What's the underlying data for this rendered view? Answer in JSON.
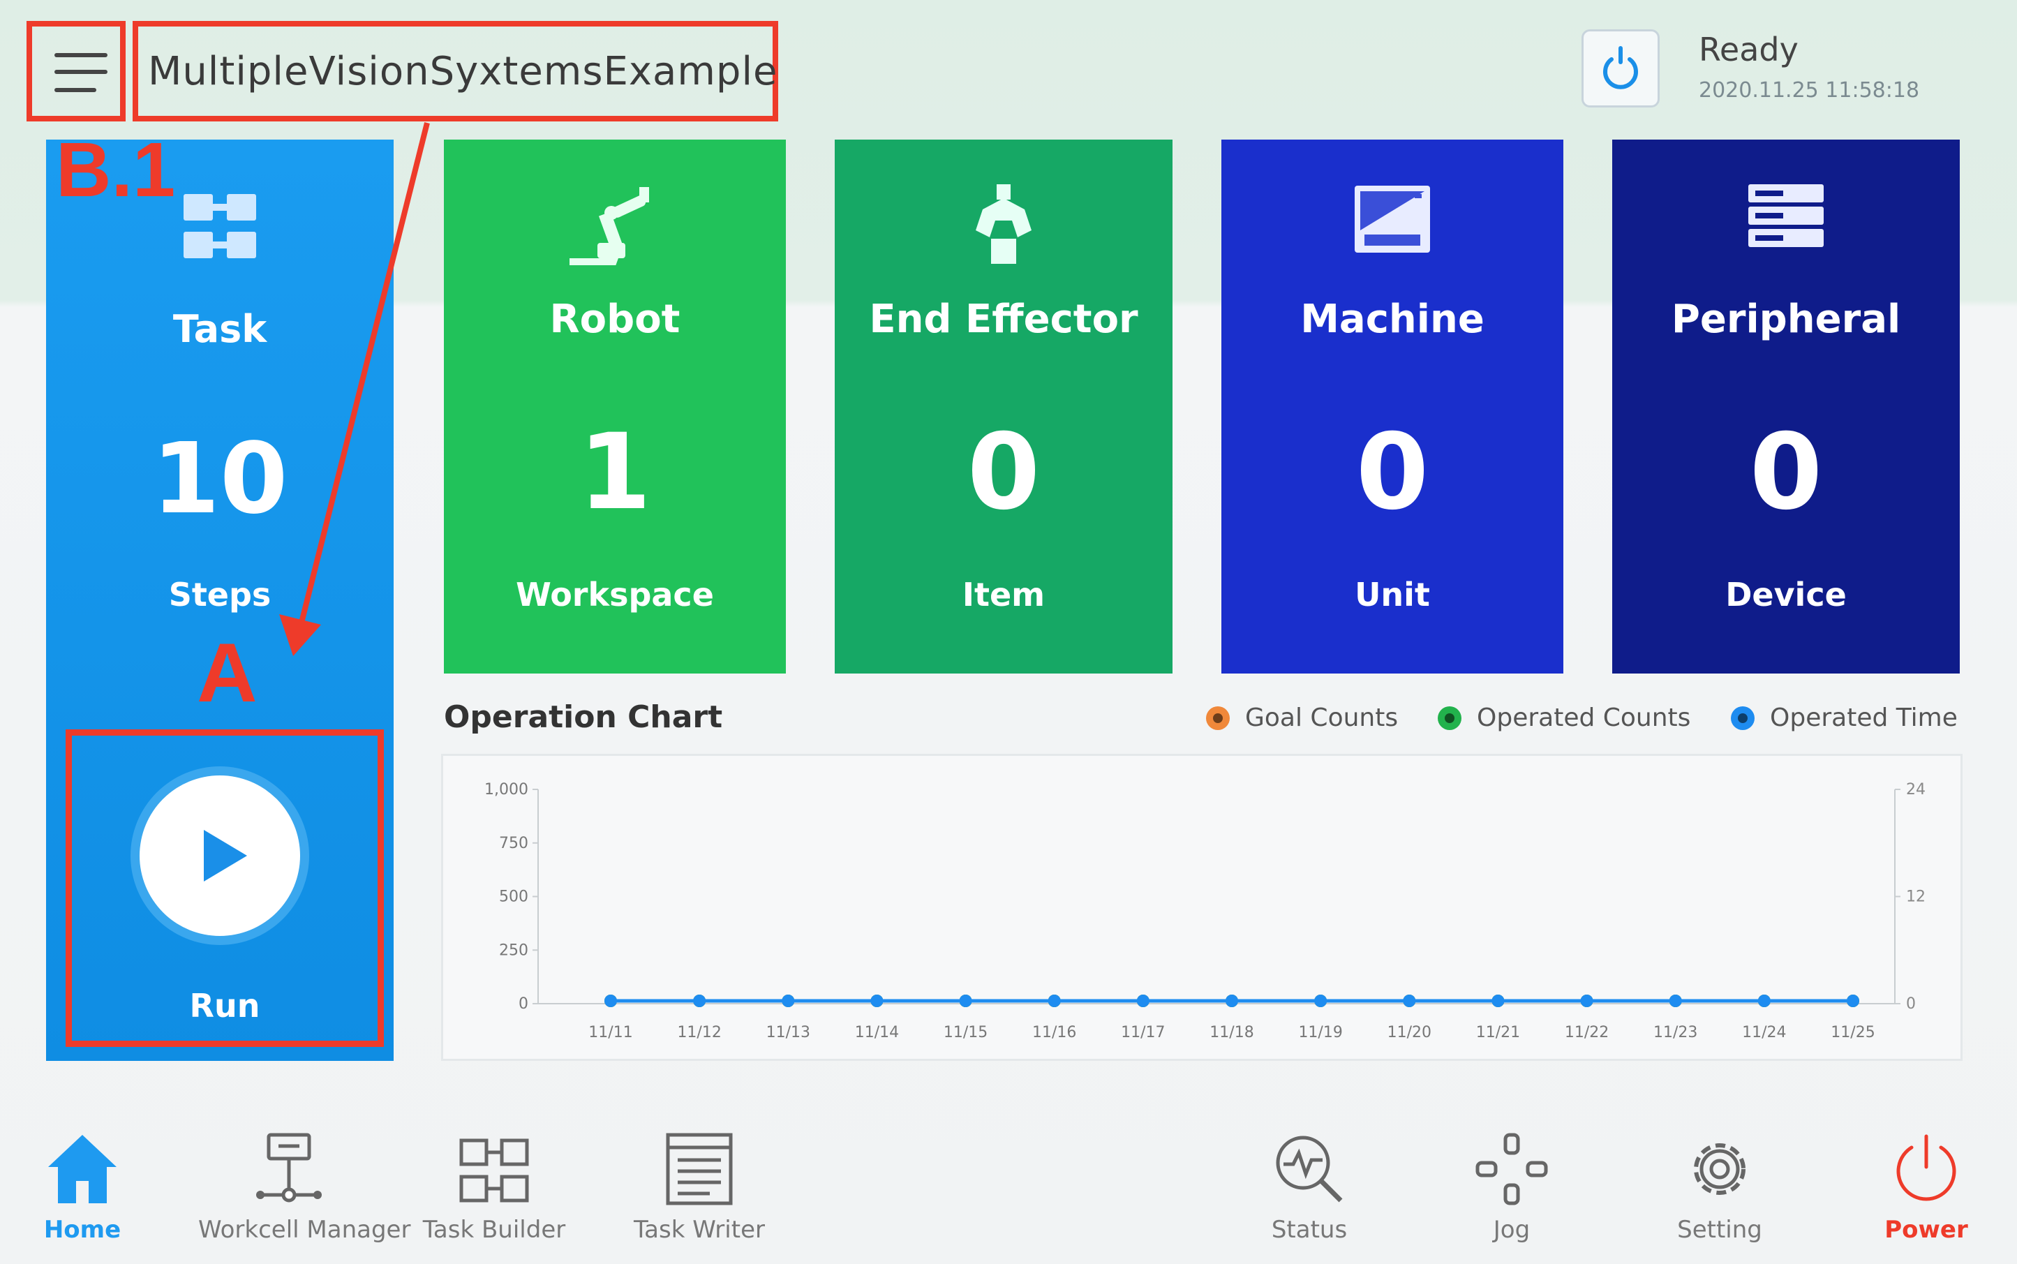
{
  "header": {
    "project_title": "MultipleVisionSyxtemsExample",
    "status": "Ready",
    "timestamp": "2020.11.25 11:58:18"
  },
  "annotations": {
    "b1": "B.1",
    "a": "A"
  },
  "task_card": {
    "title": "Task",
    "count": "10",
    "unit": "Steps",
    "run_label": "Run"
  },
  "cards": [
    {
      "title": "Robot",
      "count": "1",
      "unit": "Workspace",
      "color": "#21c25a"
    },
    {
      "title": "End Effector",
      "count": "0",
      "unit": "Item",
      "color": "#16a865"
    },
    {
      "title": "Machine",
      "count": "0",
      "unit": "Unit",
      "color": "#1a2fcc"
    },
    {
      "title": "Peripheral",
      "count": "0",
      "unit": "Device",
      "color": "#0f1c8a"
    }
  ],
  "chart": {
    "title": "Operation Chart",
    "legend": [
      {
        "name": "Goal Counts",
        "color": "#f0883a"
      },
      {
        "name": "Operated Counts",
        "color": "#22b24c"
      },
      {
        "name": "Operated Time",
        "color": "#1e8cf0"
      }
    ]
  },
  "chart_data": {
    "type": "line",
    "title": "Operation Chart",
    "categories": [
      "11/11",
      "11/12",
      "11/13",
      "11/14",
      "11/15",
      "11/16",
      "11/17",
      "11/18",
      "11/19",
      "11/20",
      "11/21",
      "11/22",
      "11/23",
      "11/24",
      "11/25"
    ],
    "y_left_ticks": [
      "1,000",
      "750",
      "500",
      "250",
      "0"
    ],
    "y_right_ticks": [
      "24",
      "12",
      "0"
    ],
    "ylim": [
      0,
      1000
    ],
    "y2lim": [
      0,
      24
    ],
    "series": [
      {
        "name": "Goal Counts",
        "values": [
          0,
          0,
          0,
          0,
          0,
          0,
          0,
          0,
          0,
          0,
          0,
          0,
          0,
          0,
          0
        ]
      },
      {
        "name": "Operated Counts",
        "values": [
          0,
          0,
          0,
          0,
          0,
          0,
          0,
          0,
          0,
          0,
          0,
          0,
          0,
          0,
          0
        ]
      },
      {
        "name": "Operated Time",
        "values": [
          0,
          0,
          0,
          0,
          0,
          0,
          0,
          0,
          0,
          0,
          0,
          0,
          0,
          0,
          0
        ]
      }
    ]
  },
  "bottom_nav": [
    {
      "label": "Home",
      "icon": "home-icon",
      "active": true
    },
    {
      "label": "Workcell Manager",
      "icon": "workcell-icon"
    },
    {
      "label": "Task Builder",
      "icon": "task-builder-icon"
    },
    {
      "label": "Task Writer",
      "icon": "task-writer-icon"
    },
    {
      "label": "Status",
      "icon": "status-icon"
    },
    {
      "label": "Jog",
      "icon": "jog-icon"
    },
    {
      "label": "Setting",
      "icon": "gear-icon"
    },
    {
      "label": "Power",
      "icon": "power-icon"
    }
  ]
}
